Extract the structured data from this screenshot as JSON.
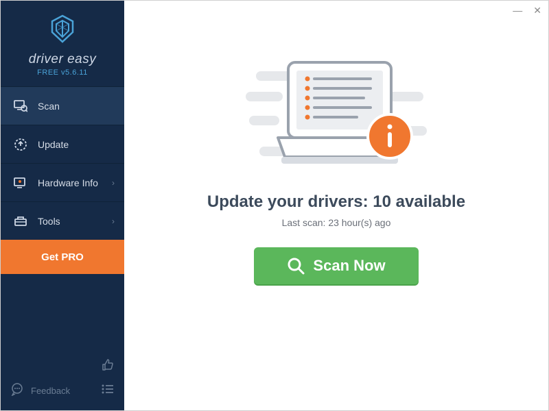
{
  "window": {
    "minimize": "—",
    "close": "✕"
  },
  "brand": {
    "name": "driver easy",
    "version": "FREE v5.6.11"
  },
  "sidebar": {
    "items": [
      {
        "label": "Scan",
        "icon": "scan-icon",
        "active": true,
        "chevron": false
      },
      {
        "label": "Update",
        "icon": "update-icon",
        "active": false,
        "chevron": false
      },
      {
        "label": "Hardware Info",
        "icon": "hardware-icon",
        "active": false,
        "chevron": true
      },
      {
        "label": "Tools",
        "icon": "tools-icon",
        "active": false,
        "chevron": true
      }
    ],
    "get_pro": "Get PRO",
    "feedback": "Feedback"
  },
  "main": {
    "headline": "Update your drivers: 10 available",
    "subline": "Last scan: 23 hour(s) ago",
    "scan_button": "Scan Now"
  }
}
